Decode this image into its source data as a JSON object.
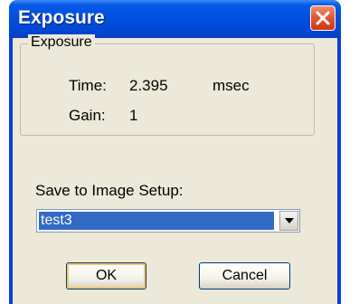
{
  "window": {
    "title": "Exposure"
  },
  "group": {
    "legend": "Exposure",
    "time_label": "Time:",
    "time_value": "2.395",
    "time_unit": "msec",
    "gain_label": "Gain:",
    "gain_value": "1"
  },
  "save": {
    "label": "Save to Image Setup:",
    "selected": "test3"
  },
  "buttons": {
    "ok": "OK",
    "cancel": "Cancel"
  },
  "icons": {
    "close": "close-icon",
    "dropdown": "chevron-down-icon"
  },
  "colors": {
    "titlebar": "#0050e0",
    "selection": "#316ac5",
    "client": "#ece9d8"
  }
}
